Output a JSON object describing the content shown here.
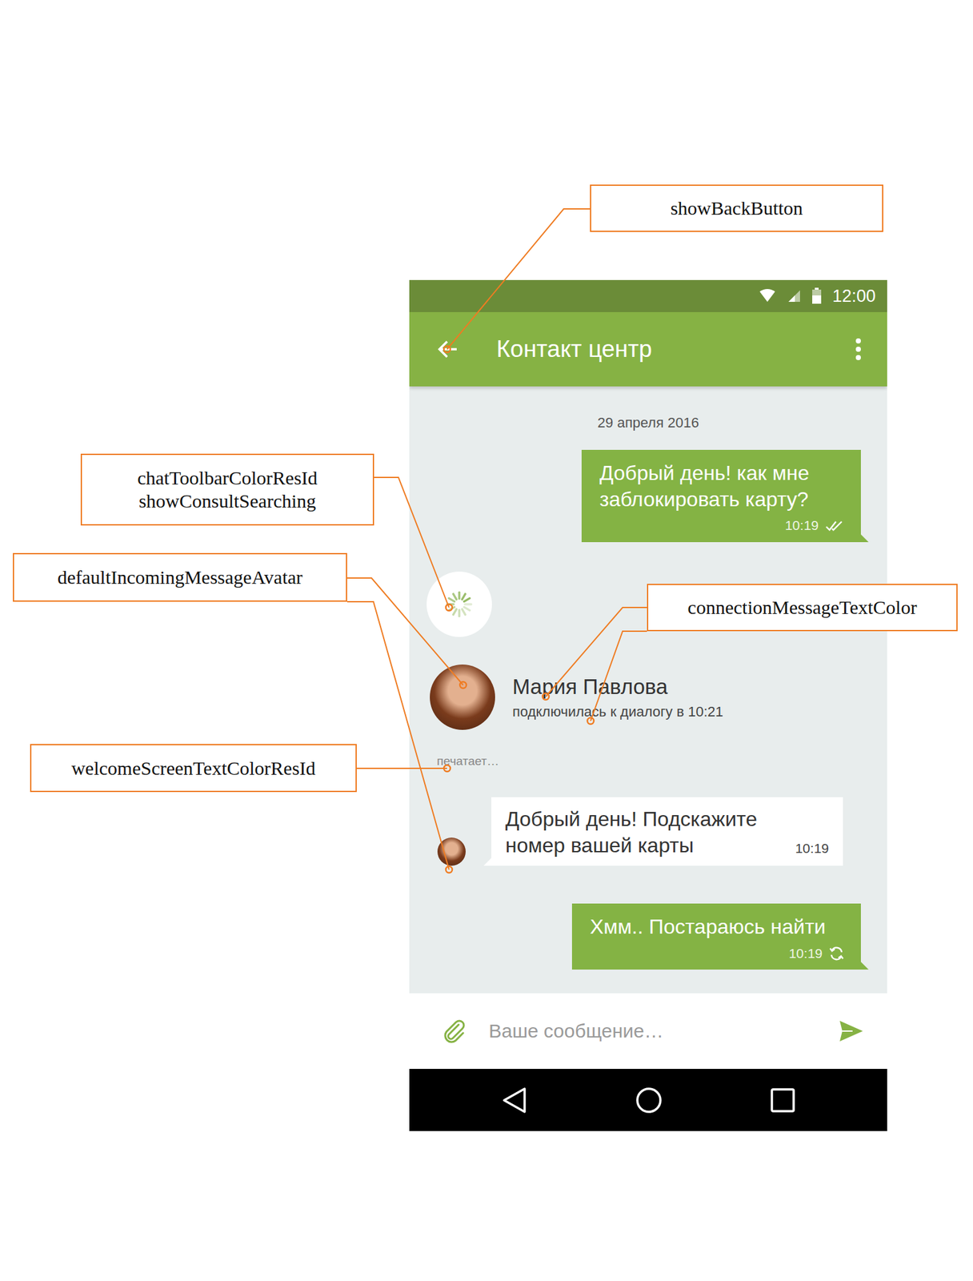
{
  "annotations": [
    {
      "lines": [
        "showBackButton"
      ]
    },
    {
      "lines": [
        "chatToolbarColorResId",
        "showConsultSearching"
      ]
    },
    {
      "lines": [
        "defaultIncomingMessageAvatar"
      ]
    },
    {
      "lines": [
        "connectionMessageTextColor"
      ]
    },
    {
      "lines": [
        "welcomeScreenTextColorResId"
      ]
    }
  ],
  "status_bar": {
    "time": "12:00"
  },
  "toolbar": {
    "title": "Контакт центр"
  },
  "chat": {
    "date": "29 апреля 2016",
    "items": [
      {
        "kind": "outgoing",
        "text": "Добрый день! как мне заблокировать карту?",
        "time": "10:19",
        "status": "read"
      },
      {
        "kind": "searching"
      },
      {
        "kind": "consultant",
        "name": "Мария Павлова",
        "text": "подключилась к диалогу в 10:21"
      },
      {
        "kind": "typing",
        "text": "печатает…"
      },
      {
        "kind": "incoming",
        "text": "Добрый день! Подскажите номер вашей карты",
        "time": "10:19"
      },
      {
        "kind": "outgoing",
        "text": "Хмм.. Постараюсь найти",
        "time": "10:19",
        "status": "sending"
      }
    ]
  },
  "input": {
    "placeholder": "Ваше сообщение…"
  }
}
